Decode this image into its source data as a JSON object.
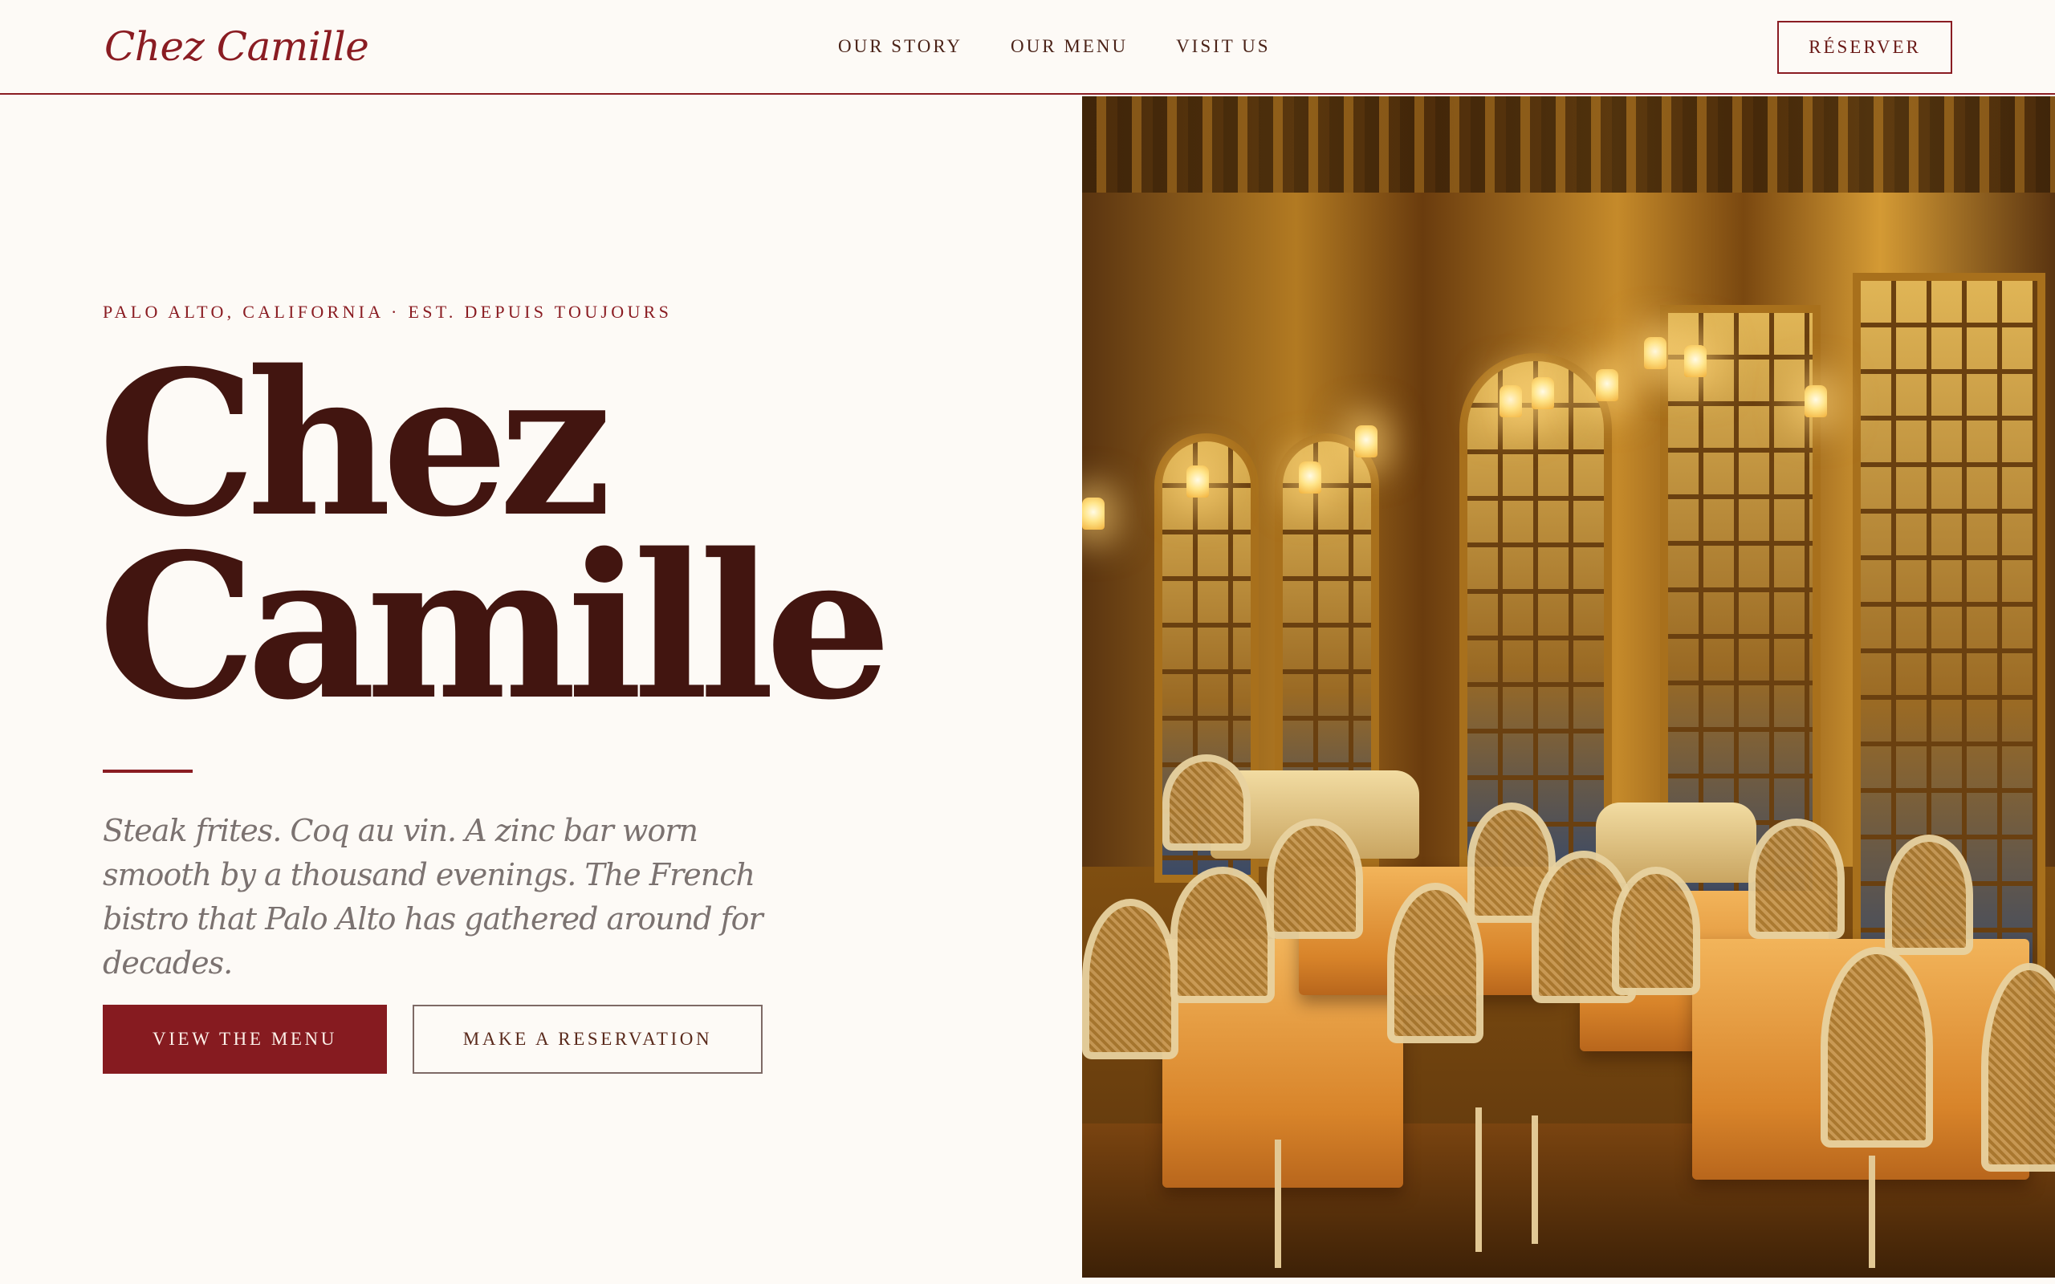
{
  "header": {
    "logo": "Chez Camille",
    "nav": [
      {
        "label": "OUR STORY"
      },
      {
        "label": "OUR MENU"
      },
      {
        "label": "VISIT US"
      }
    ],
    "reserve_label": "RÉSERVER"
  },
  "hero": {
    "eyebrow": "PALO ALTO, CALIFORNIA · EST. DEPUIS TOUJOURS",
    "title_line1": "Chez",
    "title_line2": "Camille",
    "tagline": "Steak frites. Coq au vin. A zinc bar worn smooth by a thousand evenings. The French bistro that Palo Alto has gathered around for decades.",
    "primary_button": "VIEW THE MENU",
    "secondary_button": "MAKE A RESERVATION"
  },
  "photo": {
    "subject": "ornate gilded bistro dining room with tables and cane chairs"
  },
  "colors": {
    "accent": "#8a1c22",
    "heading": "#421510",
    "background": "#fdfaf6",
    "tagline": "#7b7270"
  }
}
